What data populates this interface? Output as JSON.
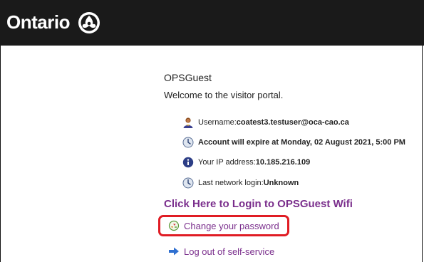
{
  "header": {
    "brand": "Ontario",
    "colors": {
      "bar": "#1a1a1a",
      "text": "#ffffff"
    },
    "logo_icon": "trillium-icon"
  },
  "portal": {
    "title": "OPSGuest",
    "welcome": "Welcome to the visitor portal."
  },
  "info": [
    {
      "icon": "user-icon",
      "label": "Username: ",
      "value": "coatest3.testuser@oca-cao.ca"
    },
    {
      "icon": "clock-icon",
      "label": "",
      "value": "Account will expire at Monday, 02 August 2021, 5:00 PM"
    },
    {
      "icon": "info-icon",
      "label": "Your IP address: ",
      "value": "10.185.216.109"
    },
    {
      "icon": "clock-icon",
      "label": "Last network login: ",
      "value": "Unknown"
    }
  ],
  "links": {
    "login": "Click Here to Login to OPSGuest Wifi",
    "change_password": "Change your password",
    "logout": "Log out of self-service",
    "link_color": "#7a2e8c",
    "highlight_color": "#e01c24"
  }
}
